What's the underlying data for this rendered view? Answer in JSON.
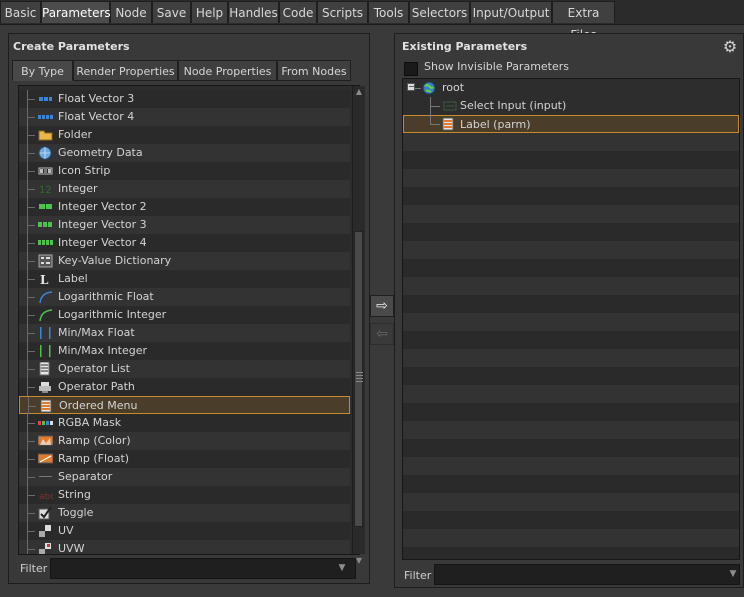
{
  "top_tabs": [
    "Basic",
    "Parameters",
    "Node",
    "Save",
    "Help",
    "Handles",
    "Code",
    "Scripts",
    "Tools",
    "Selectors",
    "Input/Output",
    "Extra Files"
  ],
  "active_top_tab": "Parameters",
  "left": {
    "title": "Create Parameters",
    "tabs": [
      "By Type",
      "Render Properties",
      "Node Properties",
      "From Nodes"
    ],
    "active_tab": "By Type",
    "items": [
      {
        "label": "Float Vector 3",
        "icon": "float-vector-3-icon"
      },
      {
        "label": "Float Vector 4",
        "icon": "float-vector-4-icon"
      },
      {
        "label": "Folder",
        "icon": "folder-icon"
      },
      {
        "label": "Geometry Data",
        "icon": "geometry-data-icon"
      },
      {
        "label": "Icon Strip",
        "icon": "icon-strip-icon"
      },
      {
        "label": "Integer",
        "icon": "integer-icon"
      },
      {
        "label": "Integer Vector 2",
        "icon": "integer-vector-2-icon"
      },
      {
        "label": "Integer Vector 3",
        "icon": "integer-vector-3-icon"
      },
      {
        "label": "Integer Vector 4",
        "icon": "integer-vector-4-icon"
      },
      {
        "label": "Key-Value Dictionary",
        "icon": "key-value-dictionary-icon"
      },
      {
        "label": "Label",
        "icon": "label-icon"
      },
      {
        "label": "Logarithmic Float",
        "icon": "logarithmic-float-icon"
      },
      {
        "label": "Logarithmic Integer",
        "icon": "logarithmic-integer-icon"
      },
      {
        "label": "Min/Max Float",
        "icon": "min-max-float-icon"
      },
      {
        "label": "Min/Max Integer",
        "icon": "min-max-integer-icon"
      },
      {
        "label": "Operator List",
        "icon": "operator-list-icon"
      },
      {
        "label": "Operator Path",
        "icon": "operator-path-icon"
      },
      {
        "label": "Ordered Menu",
        "icon": "ordered-menu-icon"
      },
      {
        "label": "RGBA Mask",
        "icon": "rgba-mask-icon"
      },
      {
        "label": "Ramp (Color)",
        "icon": "ramp-color-icon"
      },
      {
        "label": "Ramp (Float)",
        "icon": "ramp-float-icon"
      },
      {
        "label": "Separator",
        "icon": "separator-icon"
      },
      {
        "label": "String",
        "icon": "string-icon"
      },
      {
        "label": "Toggle",
        "icon": "toggle-icon"
      },
      {
        "label": "UV",
        "icon": "uv-icon"
      },
      {
        "label": "UVW",
        "icon": "uvw-icon"
      }
    ],
    "selected_item": "Ordered Menu",
    "filter_label": "Filter",
    "filter_value": ""
  },
  "middle": {
    "add_arrow": "⇨",
    "remove_arrow": "⇦"
  },
  "right": {
    "title": "Existing Parameters",
    "show_invisible_label": "Show Invisible Parameters",
    "tree": {
      "root": "root",
      "children": [
        "Select Input (input)",
        "Label (parm)"
      ],
      "selected": "Label (parm)"
    },
    "filter_label": "Filter",
    "filter_value": ""
  },
  "colors": {
    "selection_border": "#c58b2d",
    "panel_bg": "#393939",
    "list_bg": "#2d2d2d"
  }
}
